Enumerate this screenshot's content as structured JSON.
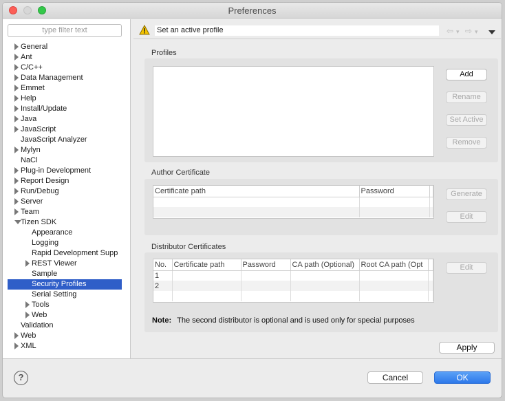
{
  "window": {
    "title": "Preferences"
  },
  "filter": {
    "placeholder": "type filter text"
  },
  "tree": [
    {
      "label": "General",
      "arrow": "closed",
      "level": 0
    },
    {
      "label": "Ant",
      "arrow": "closed",
      "level": 0
    },
    {
      "label": "C/C++",
      "arrow": "closed",
      "level": 0
    },
    {
      "label": "Data Management",
      "arrow": "closed",
      "level": 0
    },
    {
      "label": "Emmet",
      "arrow": "closed",
      "level": 0
    },
    {
      "label": "Help",
      "arrow": "closed",
      "level": 0
    },
    {
      "label": "Install/Update",
      "arrow": "closed",
      "level": 0
    },
    {
      "label": "Java",
      "arrow": "closed",
      "level": 0
    },
    {
      "label": "JavaScript",
      "arrow": "closed",
      "level": 0
    },
    {
      "label": "JavaScript Analyzer",
      "arrow": "none",
      "level": 0
    },
    {
      "label": "Mylyn",
      "arrow": "closed",
      "level": 0
    },
    {
      "label": "NaCl",
      "arrow": "none",
      "level": 0
    },
    {
      "label": "Plug-in Development",
      "arrow": "closed",
      "level": 0
    },
    {
      "label": "Report Design",
      "arrow": "closed",
      "level": 0
    },
    {
      "label": "Run/Debug",
      "arrow": "closed",
      "level": 0
    },
    {
      "label": "Server",
      "arrow": "closed",
      "level": 0
    },
    {
      "label": "Team",
      "arrow": "closed",
      "level": 0
    },
    {
      "label": "Tizen SDK",
      "arrow": "open",
      "level": 0
    },
    {
      "label": "Appearance",
      "arrow": "none",
      "level": 1
    },
    {
      "label": "Logging",
      "arrow": "none",
      "level": 1
    },
    {
      "label": "Rapid Development Supp",
      "arrow": "none",
      "level": 1
    },
    {
      "label": "REST Viewer",
      "arrow": "closed",
      "level": 1
    },
    {
      "label": "Sample",
      "arrow": "none",
      "level": 1
    },
    {
      "label": "Security Profiles",
      "arrow": "none",
      "level": 1,
      "selected": true
    },
    {
      "label": "Serial Setting",
      "arrow": "none",
      "level": 1
    },
    {
      "label": "Tools",
      "arrow": "closed",
      "level": 1
    },
    {
      "label": "Web",
      "arrow": "closed",
      "level": 1
    },
    {
      "label": "Validation",
      "arrow": "none",
      "level": 0
    },
    {
      "label": "Web",
      "arrow": "closed",
      "level": 0
    },
    {
      "label": "XML",
      "arrow": "closed",
      "level": 0
    }
  ],
  "message": {
    "text": "Set an active profile",
    "icon": "warning-icon"
  },
  "nav": {
    "back": "⇦",
    "forward": "⇨",
    "dropdown": "▾"
  },
  "profiles": {
    "title": "Profiles",
    "buttons": {
      "add": "Add",
      "rename": "Rename",
      "set_active": "Set Active",
      "remove": "Remove"
    }
  },
  "author": {
    "title": "Author Certificate",
    "columns": [
      "Certificate path",
      "Password"
    ],
    "buttons": {
      "generate": "Generate",
      "edit": "Edit"
    }
  },
  "distributor": {
    "title": "Distributor Certificates",
    "columns": [
      "No.",
      "Certificate path",
      "Password",
      "CA path (Optional)",
      "Root CA path (Opt"
    ],
    "rows": [
      "1",
      "2"
    ],
    "buttons": {
      "edit": "Edit"
    },
    "note_label": "Note:",
    "note_text": "The second distributor is optional and is used only for special purposes"
  },
  "apply_label": "Apply",
  "footer": {
    "help": "?",
    "cancel": "Cancel",
    "ok": "OK"
  },
  "colors": {
    "selection": "#2f5ec8",
    "ok_button": "#2d78ea"
  }
}
